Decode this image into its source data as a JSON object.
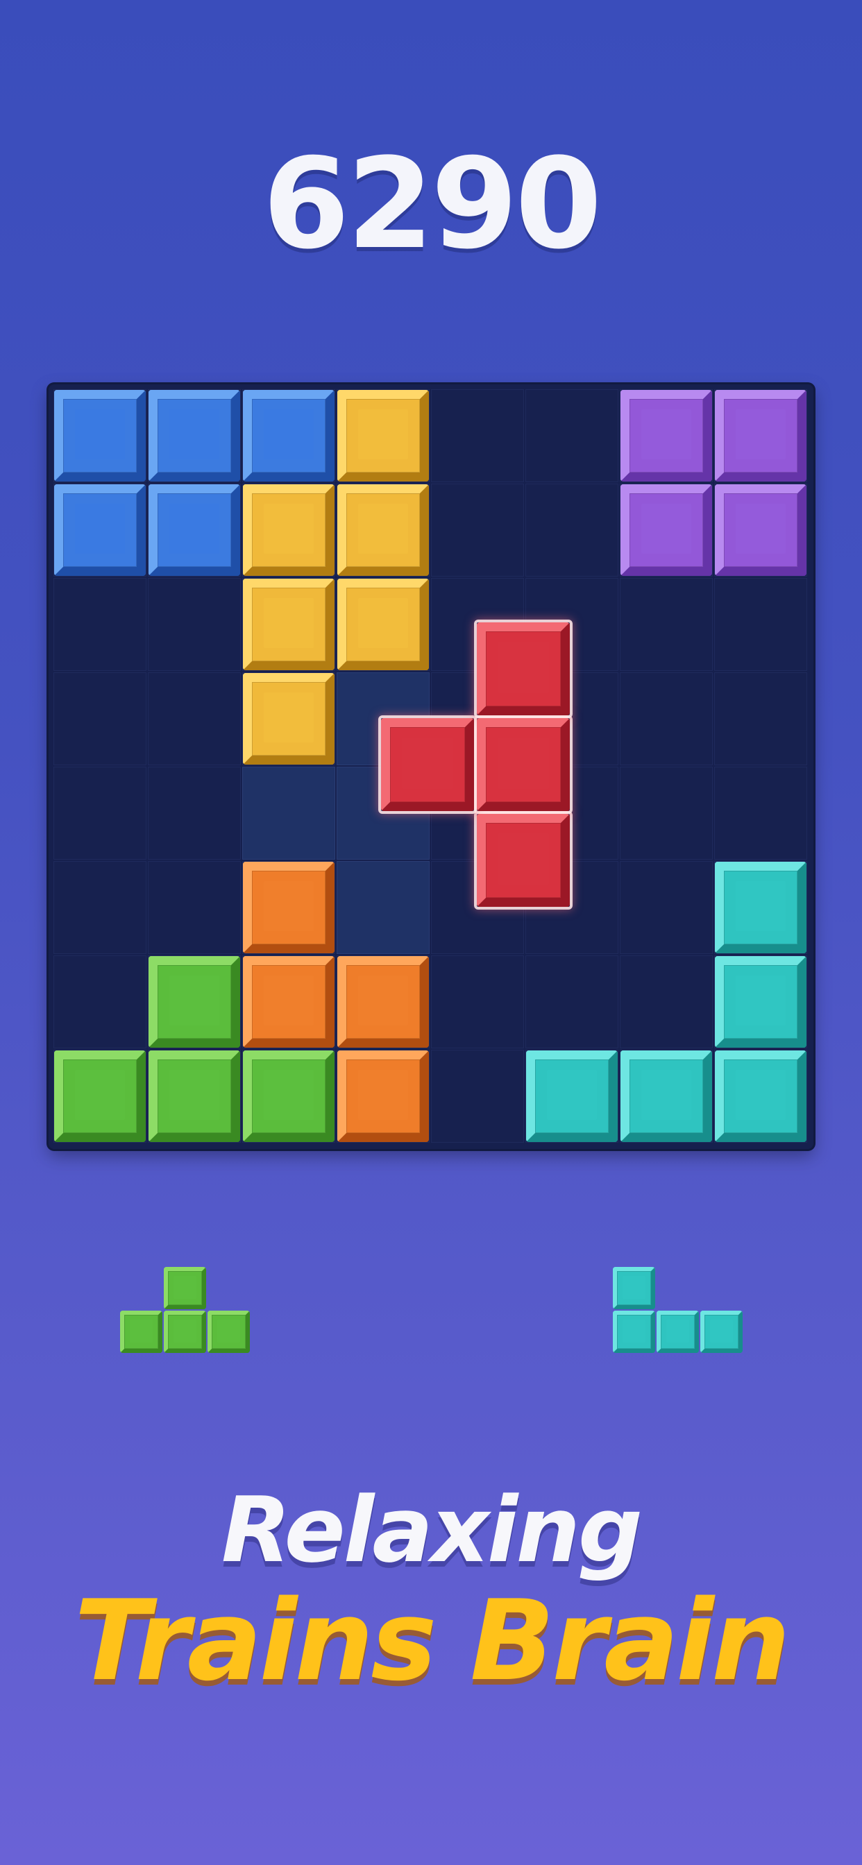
{
  "score": "6290",
  "tagline": {
    "line1": "Relaxing",
    "line2": "Trains Brain"
  },
  "colors": {
    "blue": {
      "base": "#3c7be0",
      "light": "#6aa6f3",
      "dark": "#1f4fa8",
      "face": "#3a7ae2"
    },
    "yellow": {
      "base": "#f0b93a",
      "light": "#ffd86a",
      "dark": "#b27d12",
      "face": "#f2bd3c"
    },
    "purple": {
      "base": "#9358d8",
      "light": "#b88af0",
      "dark": "#6534a8",
      "face": "#945bdb"
    },
    "red": {
      "base": "#d8323f",
      "light": "#f36a73",
      "dark": "#9b1826",
      "face": "#d83340"
    },
    "orange": {
      "base": "#ef7d2a",
      "light": "#ffa75c",
      "dark": "#b24e10",
      "face": "#f07f2c"
    },
    "green": {
      "base": "#5bbd3c",
      "light": "#8ddc66",
      "dark": "#3a8a22",
      "face": "#5cbf3e"
    },
    "cyan": {
      "base": "#2fc4c0",
      "light": "#6ee6e2",
      "dark": "#178e8c",
      "face": "#30c6c2"
    }
  },
  "board": {
    "rows": 8,
    "cols": 8,
    "grid": [
      [
        "blue",
        "blue",
        "blue",
        "yellow",
        "",
        "",
        "purple",
        "purple"
      ],
      [
        "blue",
        "blue",
        "yellow",
        "yellow",
        "",
        "",
        "purple",
        "purple"
      ],
      [
        "",
        "",
        "yellow",
        "yellow",
        "",
        "",
        "",
        ""
      ],
      [
        "",
        "",
        "yellow",
        "",
        "",
        "",
        "",
        ""
      ],
      [
        "",
        "",
        "",
        "",
        "",
        "",
        "",
        ""
      ],
      [
        "",
        "",
        "orange",
        "",
        "",
        "",
        "",
        "cyan"
      ],
      [
        "",
        "green",
        "orange",
        "orange",
        "",
        "",
        "",
        "cyan"
      ],
      [
        "green",
        "green",
        "green",
        "orange",
        "",
        "cyan",
        "cyan",
        "cyan"
      ]
    ],
    "hint_cells": [
      [
        3,
        3
      ],
      [
        4,
        2
      ],
      [
        4,
        3
      ],
      [
        5,
        3
      ]
    ]
  },
  "dragging_piece": {
    "color": "red",
    "cells": [
      [
        0,
        1
      ],
      [
        1,
        0
      ],
      [
        1,
        1
      ],
      [
        2,
        1
      ]
    ]
  },
  "tray": [
    {
      "name": "tray-piece-green-t",
      "color": "green",
      "cells": [
        [
          0,
          1
        ],
        [
          1,
          0
        ],
        [
          1,
          1
        ],
        [
          1,
          2
        ]
      ]
    },
    {
      "name": "tray-piece-cyan-l",
      "color": "cyan",
      "cells": [
        [
          0,
          0
        ],
        [
          1,
          0
        ],
        [
          1,
          1
        ],
        [
          1,
          2
        ]
      ]
    }
  ]
}
